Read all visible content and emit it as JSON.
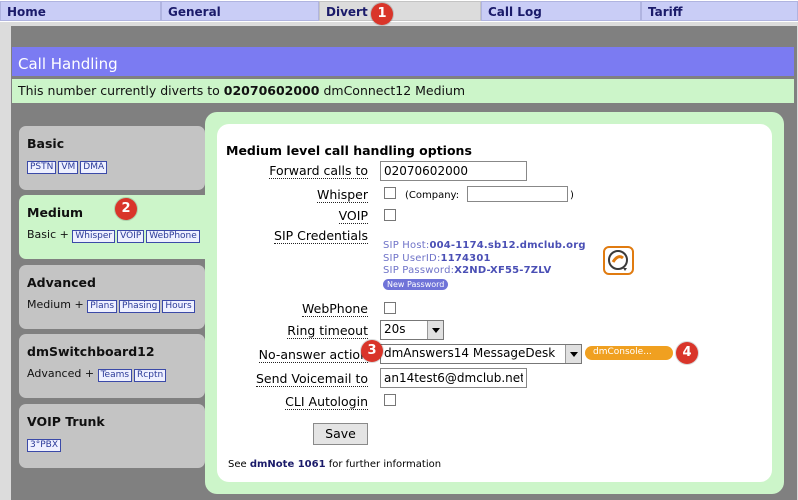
{
  "nav": {
    "tabs": [
      {
        "label": "Home"
      },
      {
        "label": "General"
      },
      {
        "label": "Divert"
      },
      {
        "label": "Call Log"
      },
      {
        "label": "Tariff"
      }
    ]
  },
  "badges": [
    "1",
    "2",
    "3",
    "4"
  ],
  "header": {
    "title": "Call Handling"
  },
  "divert": {
    "prefix": "This number currently diverts to",
    "number": "02070602000",
    "suffix": "dmConnect12 Medium"
  },
  "sidebar": {
    "items": [
      {
        "title": "Basic",
        "prefix": "",
        "chips": [
          "PSTN",
          "VM",
          "DMA"
        ]
      },
      {
        "title": "Medium",
        "prefix": "Basic +",
        "chips": [
          "Whisper",
          "VOIP",
          "WebPhone"
        ]
      },
      {
        "title": "Advanced",
        "prefix": "Medium +",
        "chips": [
          "Plans",
          "Phasing",
          "Hours"
        ]
      },
      {
        "title": "dmSwitchboard12",
        "prefix": "Advanced +",
        "chips": [
          "Teams",
          "Rcptn"
        ]
      },
      {
        "title": "VOIP Trunk",
        "prefix": "",
        "chips": [
          "3°PBX"
        ]
      }
    ]
  },
  "form": {
    "section_title": "Medium level call handling options",
    "forward_label": "Forward calls to",
    "forward_value": "02070602000",
    "whisper_label": "Whisper",
    "company_label": "(Company:",
    "company_close": ")",
    "voip_label": "VOIP",
    "sip_label": "SIP Credentials",
    "sip_host_label": "SIP Host:",
    "sip_host": "004-1174.sb12.dmclub.org",
    "sip_user_label": "SIP UserID:",
    "sip_user": "1174301",
    "sip_pass_label": "SIP Password:",
    "sip_pass": "X2ND-XF55-7ZLV",
    "new_password": "New Password",
    "webphone_label": "WebPhone",
    "ring_label": "Ring timeout",
    "ring_value": "20s",
    "noanswer_label": "No-answer action",
    "noanswer_value": "dmAnswers14 MessageDesk",
    "dmconsole": "dmConsole...",
    "voicemail_label": "Send Voicemail to",
    "voicemail_value": "an14test6@dmclub.net",
    "cli_label": "CLI Autologin",
    "save": "Save",
    "note_prefix": "See",
    "note_link": "dmNote 1061",
    "note_suffix": "for further information"
  }
}
